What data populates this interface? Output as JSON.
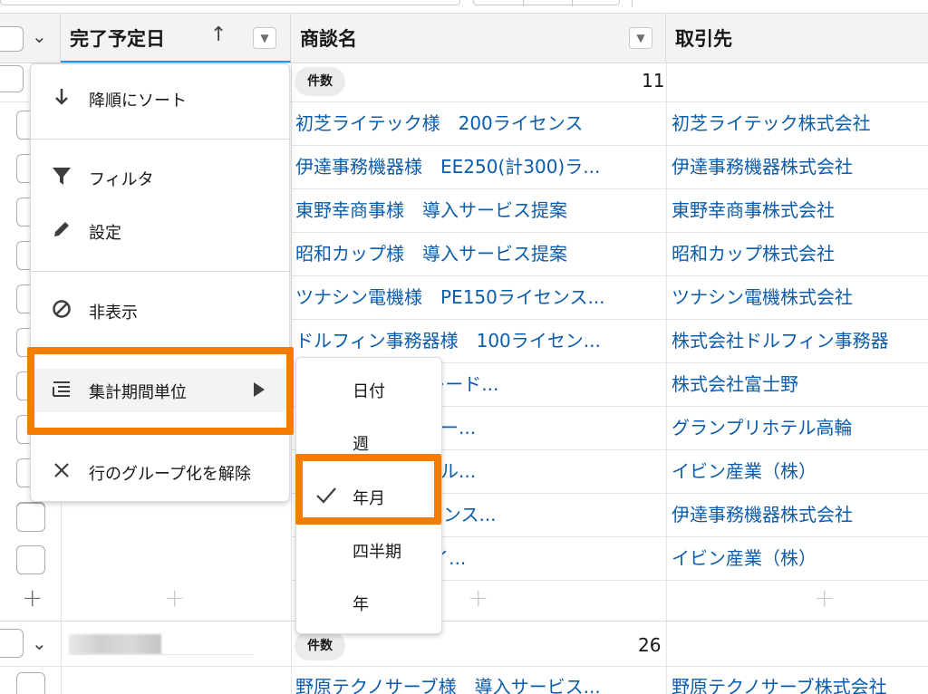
{
  "header": {
    "columns": [
      {
        "label": "完了予定日",
        "sort": "ascending"
      },
      {
        "label": "商談名"
      },
      {
        "label": "取引先"
      }
    ]
  },
  "group1": {
    "count_label": "件数",
    "count": "11",
    "rows": [
      {
        "deal": "初芝ライテック様　200ライセンス",
        "account": "初芝ライテック株式会社"
      },
      {
        "deal": "伊達事務機器様　EE250(計300)ラ...",
        "account": "伊達事務機器株式会社"
      },
      {
        "deal": "東野幸商事様　導入サービス提案",
        "account": "東野幸商事株式会社"
      },
      {
        "deal": "昭和カップ様　導入サービス提案",
        "account": "昭和カップ株式会社"
      },
      {
        "deal": "ツナシン電機様　PE150ライセンス...",
        "account": "ツナシン電機株式会社"
      },
      {
        "deal": "ドルフィン事務器様　100ライセン...",
        "account": "株式会社ドルフィン事務器"
      },
      {
        "deal": "様　EEアップグレード...",
        "account": "株式会社富士野"
      },
      {
        "deal": "ル高輪様　導入サー...",
        "account": "グランプリホテル高輪"
      },
      {
        "deal": "）様　導入コンサル...",
        "account": "イビン産業（株）"
      },
      {
        "deal": "様　PE200ライセンス...",
        "account": "伊達事務機器株式会社"
      },
      {
        "deal": "）様　MX230ライ...",
        "account": "イビン産業（株）"
      }
    ]
  },
  "group2": {
    "count_label": "件数",
    "count": "26",
    "rows": [
      {
        "deal": "野原テクノサーブ様　導入サービス...",
        "account": "野原テクノサーブ株式会社"
      }
    ]
  },
  "menu": {
    "items": [
      {
        "label": "降順にソート",
        "icon": "arrow-down-icon"
      },
      {
        "label": "フィルタ",
        "icon": "filter-icon"
      },
      {
        "label": "設定",
        "icon": "pencil-icon"
      },
      {
        "label": "非表示",
        "icon": "ban-icon"
      },
      {
        "label": "集計期間単位",
        "icon": "list-icon",
        "has_submenu": true,
        "highlighted": true
      },
      {
        "label": "行のグループ化を解除",
        "icon": "close-icon"
      }
    ]
  },
  "submenu": {
    "items": [
      {
        "label": "日付",
        "checked": false
      },
      {
        "label": "週",
        "checked": false
      },
      {
        "label": "年月",
        "checked": true,
        "highlighted": true
      },
      {
        "label": "四半期",
        "checked": false
      },
      {
        "label": "年",
        "checked": false
      }
    ]
  },
  "colors": {
    "link": "#0b5cab",
    "highlight": "#f57c00",
    "header_bg": "#f3f3f3"
  }
}
